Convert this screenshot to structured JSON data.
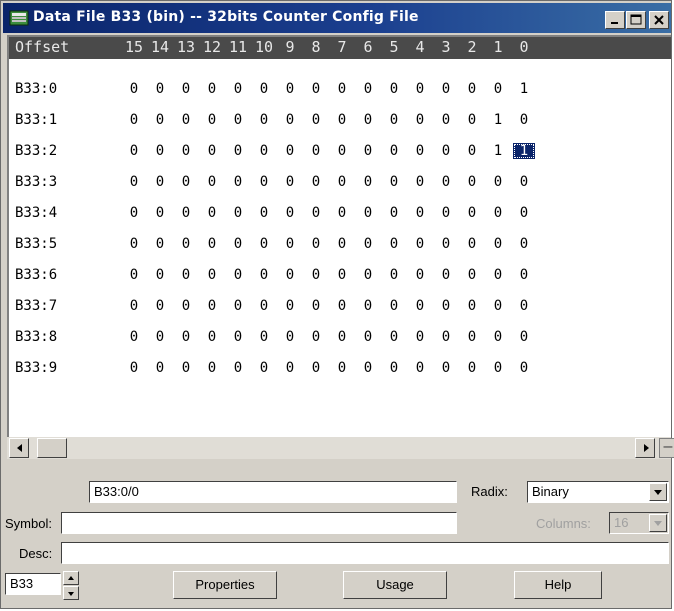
{
  "window": {
    "title": "Data File B33 (bin) -- 32bits Counter Config File"
  },
  "grid": {
    "offset_header": "Offset",
    "bit_headers": [
      "15",
      "14",
      "13",
      "12",
      "11",
      "10",
      "9",
      "8",
      "7",
      "6",
      "5",
      "4",
      "3",
      "2",
      "1",
      "0"
    ],
    "rows": [
      {
        "addr": "B33:0",
        "bits": [
          "0",
          "0",
          "0",
          "0",
          "0",
          "0",
          "0",
          "0",
          "0",
          "0",
          "0",
          "0",
          "0",
          "0",
          "0",
          "1"
        ]
      },
      {
        "addr": "B33:1",
        "bits": [
          "0",
          "0",
          "0",
          "0",
          "0",
          "0",
          "0",
          "0",
          "0",
          "0",
          "0",
          "0",
          "0",
          "0",
          "1",
          "0"
        ]
      },
      {
        "addr": "B33:2",
        "bits": [
          "0",
          "0",
          "0",
          "0",
          "0",
          "0",
          "0",
          "0",
          "0",
          "0",
          "0",
          "0",
          "0",
          "0",
          "1",
          "1"
        ]
      },
      {
        "addr": "B33:3",
        "bits": [
          "0",
          "0",
          "0",
          "0",
          "0",
          "0",
          "0",
          "0",
          "0",
          "0",
          "0",
          "0",
          "0",
          "0",
          "0",
          "0"
        ]
      },
      {
        "addr": "B33:4",
        "bits": [
          "0",
          "0",
          "0",
          "0",
          "0",
          "0",
          "0",
          "0",
          "0",
          "0",
          "0",
          "0",
          "0",
          "0",
          "0",
          "0"
        ]
      },
      {
        "addr": "B33:5",
        "bits": [
          "0",
          "0",
          "0",
          "0",
          "0",
          "0",
          "0",
          "0",
          "0",
          "0",
          "0",
          "0",
          "0",
          "0",
          "0",
          "0"
        ]
      },
      {
        "addr": "B33:6",
        "bits": [
          "0",
          "0",
          "0",
          "0",
          "0",
          "0",
          "0",
          "0",
          "0",
          "0",
          "0",
          "0",
          "0",
          "0",
          "0",
          "0"
        ]
      },
      {
        "addr": "B33:7",
        "bits": [
          "0",
          "0",
          "0",
          "0",
          "0",
          "0",
          "0",
          "0",
          "0",
          "0",
          "0",
          "0",
          "0",
          "0",
          "0",
          "0"
        ]
      },
      {
        "addr": "B33:8",
        "bits": [
          "0",
          "0",
          "0",
          "0",
          "0",
          "0",
          "0",
          "0",
          "0",
          "0",
          "0",
          "0",
          "0",
          "0",
          "0",
          "0"
        ]
      },
      {
        "addr": "B33:9",
        "bits": [
          "0",
          "0",
          "0",
          "0",
          "0",
          "0",
          "0",
          "0",
          "0",
          "0",
          "0",
          "0",
          "0",
          "0",
          "0",
          "0"
        ]
      }
    ],
    "selected": {
      "row": 2,
      "bit": "0"
    }
  },
  "address_field": {
    "value": "B33:0/0"
  },
  "radix": {
    "label": "Radix:",
    "value": "Binary"
  },
  "symbol": {
    "label": "Symbol:",
    "value": ""
  },
  "columns": {
    "label": "Columns:",
    "value": "16"
  },
  "desc": {
    "label": "Desc:",
    "value": ""
  },
  "file_spinner": {
    "value": "B33"
  },
  "buttons": {
    "properties": "Properties",
    "usage": "Usage",
    "help": "Help"
  },
  "icons": [
    "data-file-icon",
    "minimize-icon",
    "maximize-icon",
    "close-icon",
    "scroll-left-icon",
    "scroll-right-icon",
    "dropdown-arrow-icon",
    "spinner-up-icon",
    "spinner-down-icon"
  ],
  "colors": {
    "titlebar": "#0a246a",
    "header_bg": "#4a4a4a",
    "selection": "#0a246a",
    "face": "#d4d0c8"
  }
}
